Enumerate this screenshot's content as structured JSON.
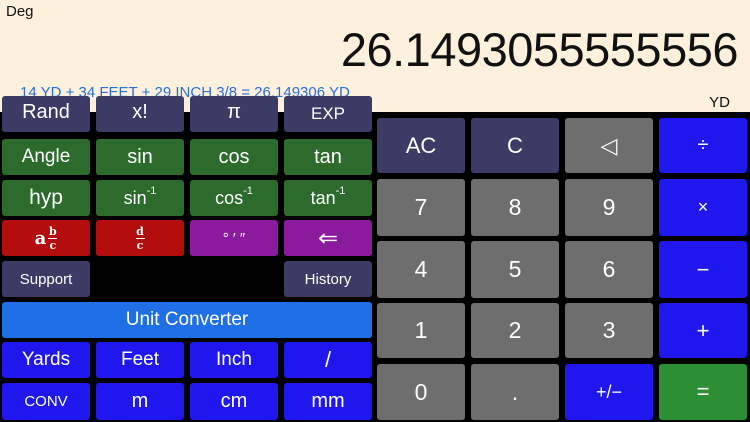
{
  "display": {
    "mode": "Deg",
    "result": "26.1493055555556",
    "expression": "14 YD + 34 FEET + 29 INCH 3/8 = 26.149306 YD",
    "unit": "YD"
  },
  "sci_keys": {
    "rand": "Rand",
    "factorial": "x!",
    "pi": "π",
    "exp": "EXP",
    "angle": "Angle",
    "sin": "sin",
    "cos": "cos",
    "tan": "tan",
    "hyp": "hyp",
    "asin_base": "sin",
    "acos_base": "cos",
    "atan_base": "tan",
    "inverse_sup": "-1",
    "frac_whole": "a",
    "frac_num": "b",
    "frac_den": "c",
    "deriv_num": "d",
    "deriv_den": "c",
    "dms": "° ′ ″",
    "backspace_arrow": "⇐",
    "support": "Support",
    "history": "History",
    "unit_converter": "Unit Converter",
    "yards": "Yards",
    "feet": "Feet",
    "inch": "Inch",
    "slash": "/",
    "conv": "CONV",
    "m": "m",
    "cm": "cm",
    "mm": "mm"
  },
  "num_keys": {
    "ac": "AC",
    "c": "C",
    "backspace": "◁",
    "divide": "÷",
    "multiply": "×",
    "minus": "−",
    "plus": "+",
    "equals": "=",
    "n7": "7",
    "n8": "8",
    "n9": "9",
    "n4": "4",
    "n5": "5",
    "n6": "6",
    "n1": "1",
    "n2": "2",
    "n3": "3",
    "n0": "0",
    "dot": ".",
    "plus_minus": "+/−"
  },
  "colors": {
    "display_bg": "#fdf1de",
    "expression_text": "#2a6fd4",
    "key_navy": "#3b3b66",
    "key_green": "#2d6b2d",
    "key_red": "#b30d0d",
    "key_purple": "#8a1b9c",
    "key_light_blue": "#1f6fe6",
    "key_dark_blue": "#1f17ee",
    "key_gray": "#6e6e6e",
    "key_equals_green": "#2c8f33"
  }
}
